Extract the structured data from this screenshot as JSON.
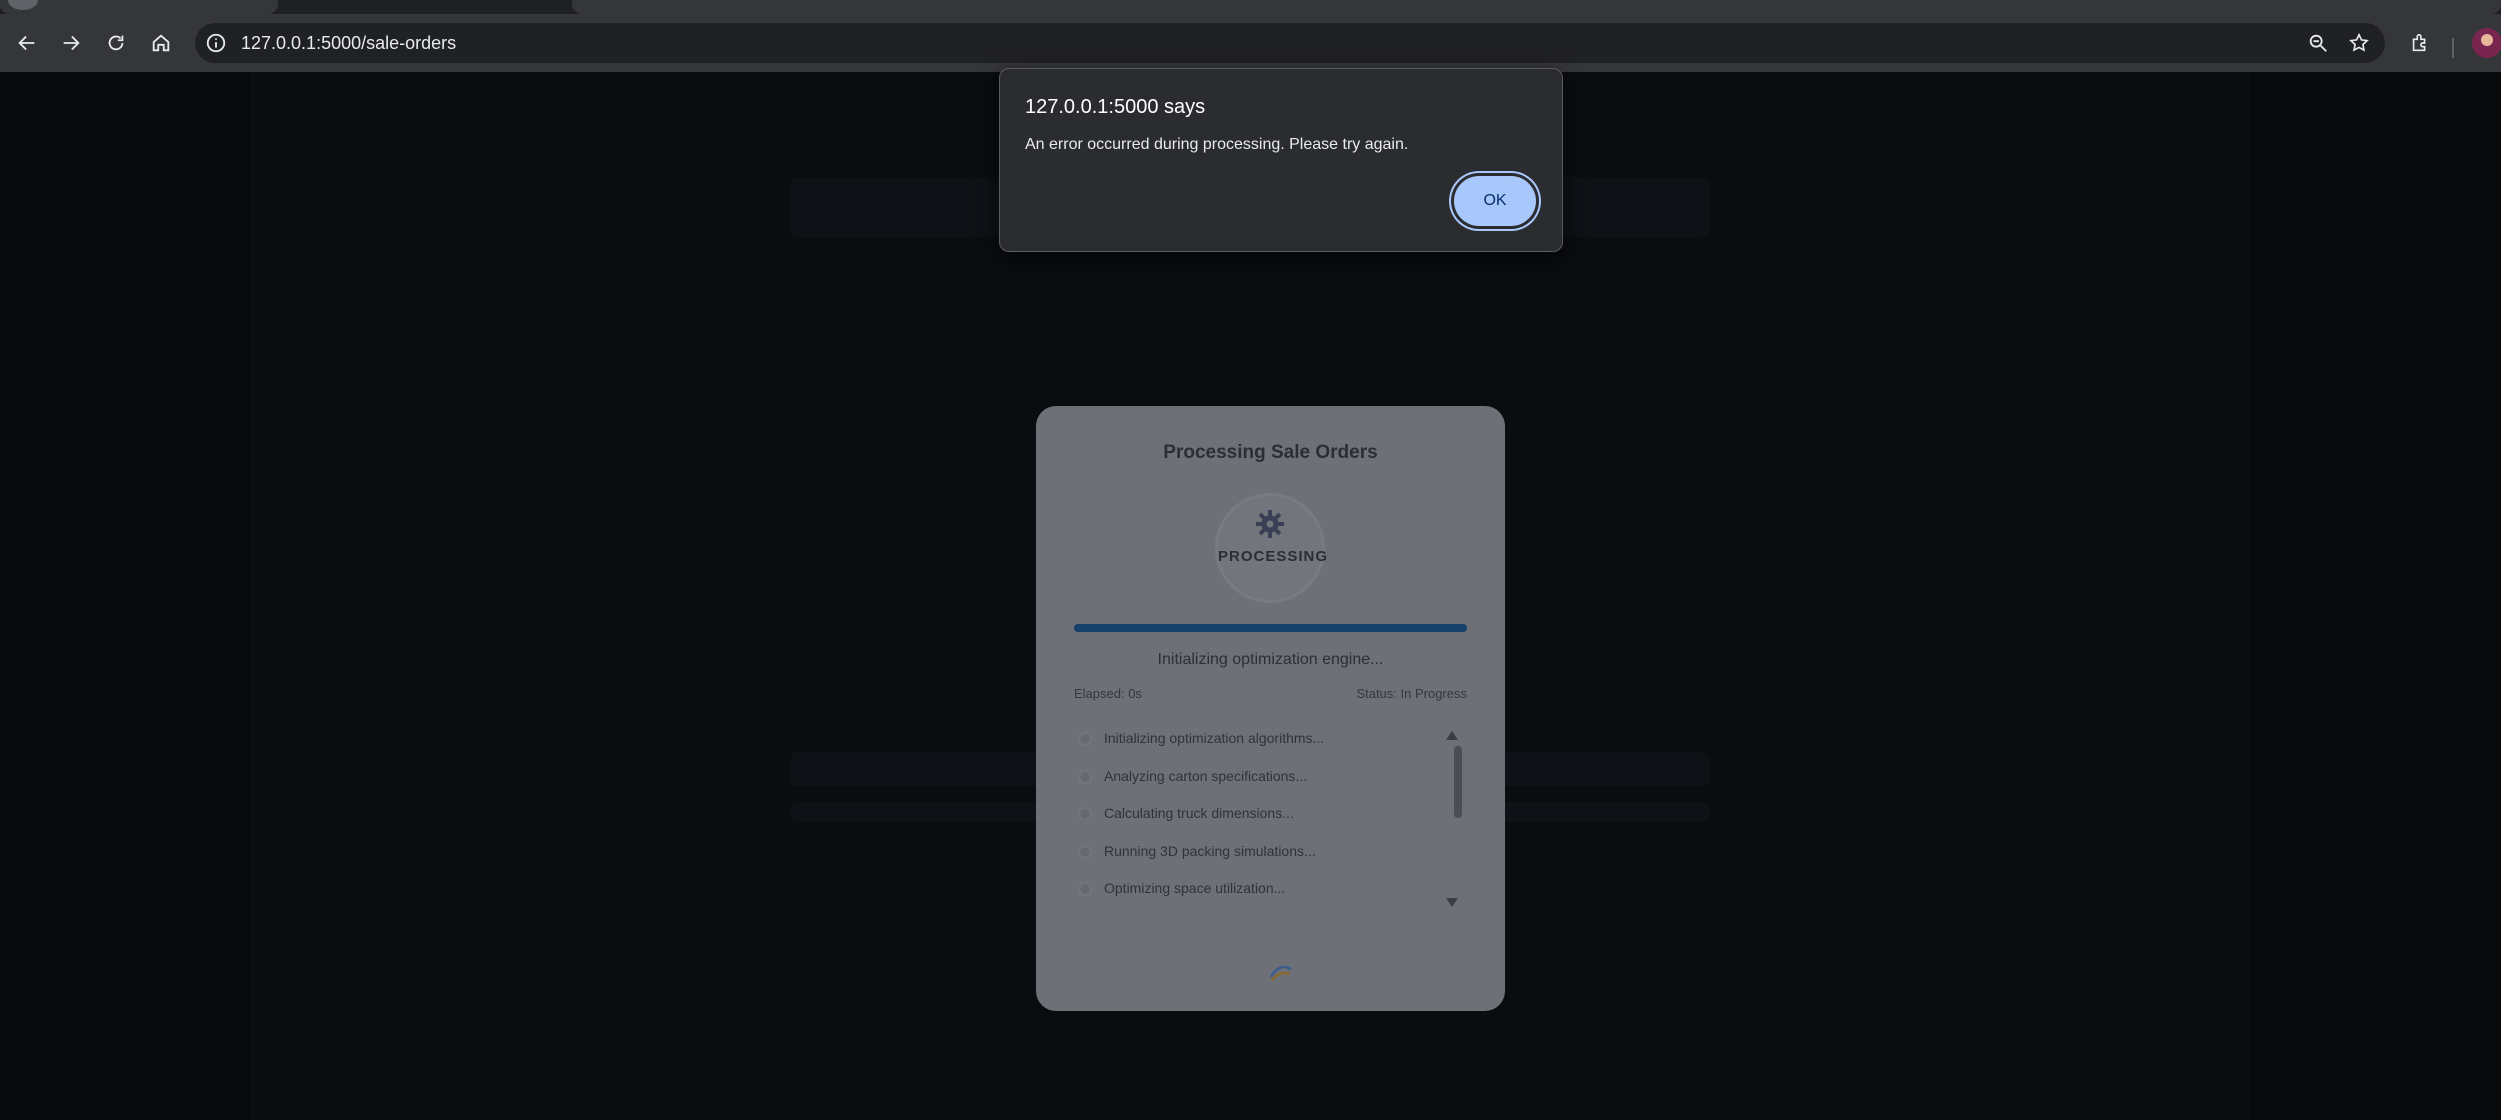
{
  "browser": {
    "url": "127.0.0.1:5000/sale-orders",
    "icons": [
      "back-arrow-icon",
      "forward-arrow-icon",
      "reload-icon",
      "home-icon",
      "site-info-icon",
      "zoom-icon",
      "bookmark-star-icon",
      "extensions-icon",
      "profile-avatar"
    ]
  },
  "modal": {
    "title": "Processing Sale Orders",
    "spinner_label": "PROCESSING",
    "progress_fraction": 1.0,
    "status_message": "Initializing optimization engine...",
    "elapsed": "Elapsed: 0s",
    "status": "Status: In Progress",
    "steps": [
      {
        "label": "Initializing optimization algorithms..."
      },
      {
        "label": "Analyzing carton specifications..."
      },
      {
        "label": "Calculating truck dimensions..."
      },
      {
        "label": "Running 3D packing simulations..."
      },
      {
        "label": "Optimizing space utilization..."
      }
    ]
  },
  "alert": {
    "title": "127.0.0.1:5000 says",
    "message": "An error occurred during processing. Please try again.",
    "ok_label": "OK",
    "accent_color": "#a8c7fa"
  }
}
